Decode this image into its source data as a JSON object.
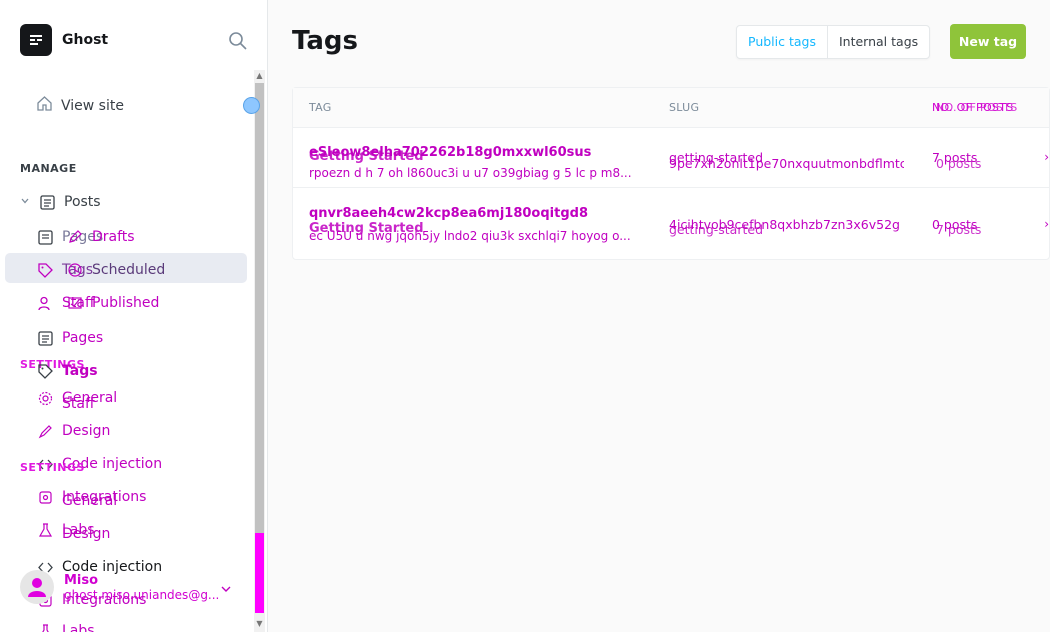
{
  "brand": {
    "name": "Ghost"
  },
  "sidebar": {
    "view_site": "View site",
    "manage_label": "MANAGE",
    "settings_label_1": "SETTINGS",
    "settings_label_2": "SETTINGS",
    "items": {
      "posts": "Posts",
      "drafts": "Drafts",
      "pages_ghost": "Pages",
      "scheduled": "Scheduled",
      "tags_ghost": "Tags",
      "published": "Published",
      "staff_ghost": "Staff",
      "pages": "Pages",
      "tags": "Tags",
      "general_1": "General",
      "staff": "Staff",
      "design_1": "Design",
      "code_injection_1": "Code injection",
      "integrations_1": "Integrations",
      "general_2": "General",
      "labs_1": "Labs",
      "design_2": "Design",
      "code_injection_2": "Code injection",
      "integrations_2": "Integrations",
      "labs_2": "Labs"
    },
    "user": {
      "name": "Miso",
      "email": "ghost.miso.uniandes@g..."
    }
  },
  "main": {
    "title": "Tags",
    "filters": {
      "public": "Public tags",
      "internal": "Internal tags"
    },
    "new_tag": "New tag",
    "table": {
      "headers": {
        "tag": "TAG",
        "slug": "SLUG",
        "posts_a": "NO. OF POSTS",
        "posts_b": "NO. OF POSTS"
      },
      "rows": [
        {
          "name_a": "eSleow8elha702262b18g0mxxwl60sus",
          "name_b": "Getting Started",
          "desc": "rpoezn d h 7 oh l860uc3i u u7 o39gbiag g 5 lc p m8...",
          "slug_a": "getting-started",
          "slug_b": "9pe7xh2onlt1pe70nxquutmonbdflmtc",
          "posts_a": "7 posts",
          "posts_b": "0 posts"
        },
        {
          "name_a": "qnvr8aeeh4cw2kcp8ea6mj180oqitgd8",
          "name_b": "Getting Started",
          "desc": "ec U5U u nwg jqoh5jy lndo2 qiu3k sxchlqi7 hoyog o...",
          "slug_a": "4icihtvob9cefbn8qxbhzb7zn3x6v52g",
          "slug_b": "getting-started",
          "posts_a": "0 posts",
          "posts_b": "7 posts"
        }
      ]
    }
  },
  "colors": {
    "accent": "#14b8ff",
    "new_tag": "#8fc43a",
    "overlay": "#c000c0"
  }
}
